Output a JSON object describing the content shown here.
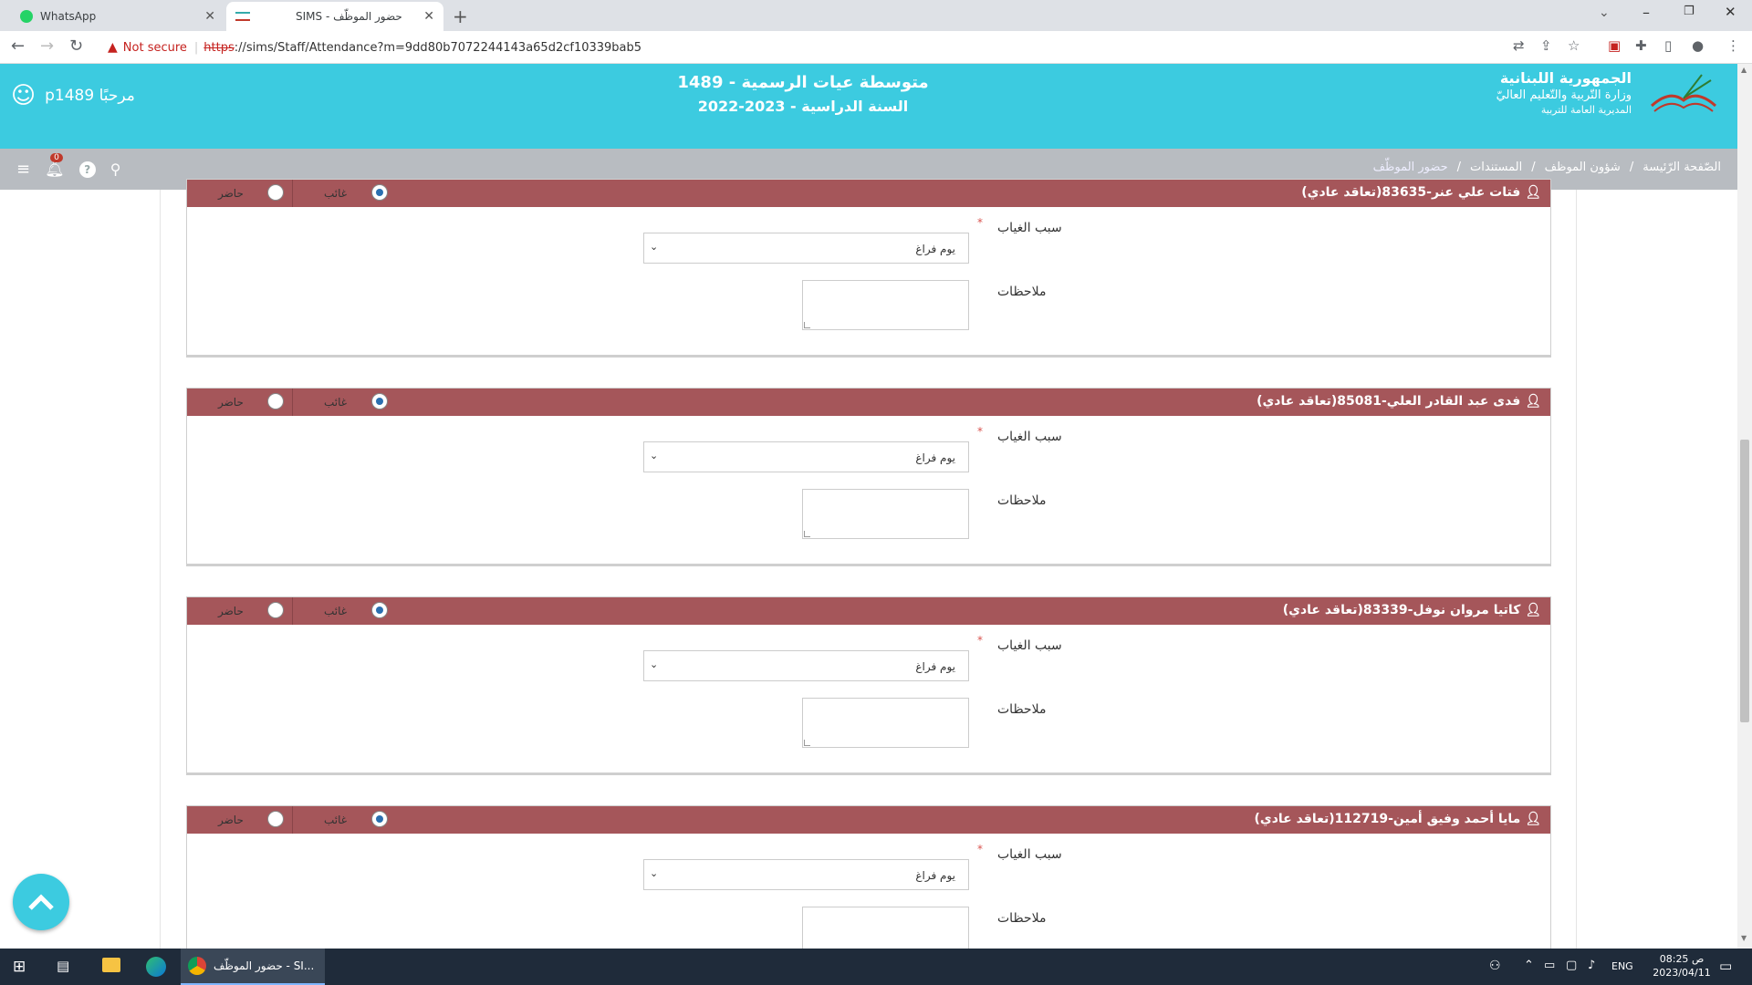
{
  "browser": {
    "tabs": [
      {
        "title": "WhatsApp"
      },
      {
        "title": "حضور الموظّف - SIMS"
      }
    ],
    "security_label": "Not secure",
    "url_scheme": "https",
    "url_rest": "://sims/Staff/Attendance?m=9dd80b7072244143a65d2cf10339bab5"
  },
  "header": {
    "ministry_line1": "الجمهورية اللبنانية",
    "ministry_line2": "وزارة التّربية والتّعليم العاليّ",
    "ministry_line3": "المديرية العامة للتربية",
    "school_name": "متوسطة عيات الرسمية - 1489",
    "school_year": "السنة الدراسية - 2023-2022",
    "greeting": "مرحبًا p1489",
    "notification_count": "0"
  },
  "breadcrumb": {
    "items": [
      "الصّفحة الرّئيسة",
      "شؤون الموظف",
      "المستندات",
      "حضور الموظّف"
    ]
  },
  "form_labels": {
    "absent": "غائب",
    "present": "حاضر",
    "absence_reason": "سبب الغياب",
    "notes": "ملاحظات",
    "required_mark": "*"
  },
  "staff": [
    {
      "name": "فتات علي عنر-83635(تعاقد عادي)",
      "status": "absent",
      "reason": "يوم فراغ"
    },
    {
      "name": "فدى عبد القادر العلي-85081(تعاقد عادي)",
      "status": "absent",
      "reason": "يوم فراغ"
    },
    {
      "name": "كاتيا مروان نوفل-83339(تعاقد عادي)",
      "status": "absent",
      "reason": "يوم فراغ"
    },
    {
      "name": "مايا أحمد وفيق أمين-112719(تعاقد عادي)",
      "status": "absent",
      "reason": "يوم فراغ"
    }
  ],
  "taskbar": {
    "chrome_item": "حضور الموظّف - SI...",
    "language": "ENG",
    "time": "08:25 ص",
    "date": "2023/04/11"
  }
}
